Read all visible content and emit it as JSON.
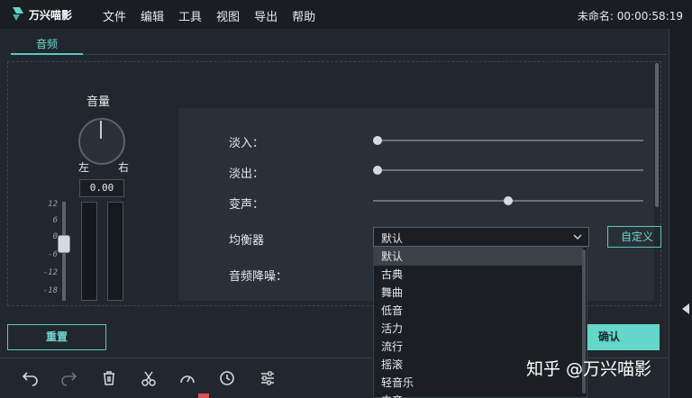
{
  "app": {
    "brand": "万兴喵影",
    "menu": [
      "文件",
      "编辑",
      "工具",
      "视图",
      "导出",
      "帮助"
    ],
    "project": "未命名: 00:00:58:19"
  },
  "tab": {
    "label": "音频"
  },
  "volume": {
    "title": "音量",
    "left": "左",
    "right": "右",
    "value": "0.00",
    "scale": [
      "12",
      "6",
      "0",
      "-6",
      "-12",
      "-18"
    ]
  },
  "settings": {
    "fade_in": {
      "label": "淡入：",
      "level": 0
    },
    "fade_out": {
      "label": "淡出：",
      "level": 0
    },
    "pitch": {
      "label": "变声：",
      "level": 0.5
    },
    "equalizer": {
      "label": "均衡器",
      "value": "默认",
      "custom_label": "自定义"
    },
    "denoise": {
      "label": "音频降噪："
    }
  },
  "dropdown": {
    "items": [
      "默认",
      "古典",
      "舞曲",
      "低音",
      "活力",
      "流行",
      "摇滚",
      "轻音乐",
      "电音"
    ],
    "selected_index": 0
  },
  "buttons": {
    "reset": "重置",
    "ok": "确认"
  },
  "toolbar": [
    "undo-icon",
    "redo-icon",
    "delete-icon",
    "cut-icon",
    "speed-icon",
    "clock-icon",
    "adjust-icon"
  ],
  "watermark": "知乎 @万兴喵影",
  "colors": {
    "accent": "#58c9c0",
    "ok_bg": "#64d6ca"
  }
}
